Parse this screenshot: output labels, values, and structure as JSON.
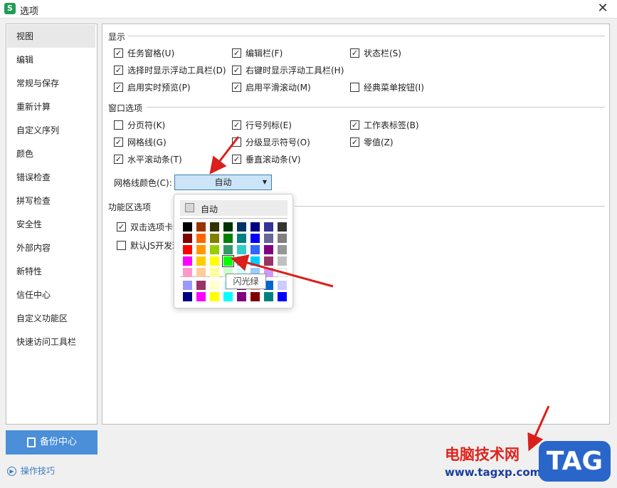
{
  "window": {
    "title": "选项",
    "app_icon": "S"
  },
  "sidebar": {
    "items": [
      {
        "label": "视图",
        "active": true
      },
      {
        "label": "编辑"
      },
      {
        "label": "常规与保存"
      },
      {
        "label": "重新计算"
      },
      {
        "label": "自定义序列"
      },
      {
        "label": "颜色"
      },
      {
        "label": "错误检查"
      },
      {
        "label": "拼写检查"
      },
      {
        "label": "安全性"
      },
      {
        "label": "外部内容"
      },
      {
        "label": "新特性"
      },
      {
        "label": "信任中心"
      },
      {
        "label": "自定义功能区"
      },
      {
        "label": "快速访问工具栏"
      }
    ],
    "backup_label": "备份中心",
    "tips_label": "操作技巧"
  },
  "sections": {
    "display": {
      "title": "显示",
      "options": [
        {
          "label": "任务窗格(U)",
          "checked": true
        },
        {
          "label": "编辑栏(F)",
          "checked": true
        },
        {
          "label": "状态栏(S)",
          "checked": true
        },
        {
          "label": "选择时显示浮动工具栏(D)",
          "checked": true
        },
        {
          "label": "右键时显示浮动工具栏(H)",
          "checked": true
        },
        {
          "label": "启用实时预览(P)",
          "checked": true
        },
        {
          "label": "启用平滑滚动(M)",
          "checked": true
        },
        {
          "label": "经典菜单按钮(I)",
          "checked": false
        }
      ]
    },
    "window_options": {
      "title": "窗口选项",
      "options": [
        {
          "label": "分页符(K)",
          "checked": false
        },
        {
          "label": "行号列标(E)",
          "checked": true
        },
        {
          "label": "工作表标签(B)",
          "checked": true
        },
        {
          "label": "网格线(G)",
          "checked": true
        },
        {
          "label": "分级显示符号(O)",
          "checked": false
        },
        {
          "label": "零值(Z)",
          "checked": true
        },
        {
          "label": "水平滚动条(T)",
          "checked": true
        },
        {
          "label": "垂直滚动条(V)",
          "checked": true
        }
      ],
      "grid_color_label": "网格线颜色(C):",
      "grid_color_value": "自动"
    },
    "ribbon": {
      "title": "功能区选项",
      "options": [
        {
          "label": "双击选项卡时",
          "checked": true
        },
        {
          "label": "默认JS开发环",
          "checked": false
        }
      ]
    }
  },
  "color_popup": {
    "auto_label": "自动",
    "tooltip": "闪光绿",
    "colors": [
      [
        "#000000",
        "#993300",
        "#333300",
        "#003300",
        "#003366",
        "#000080",
        "#333399",
        "#333333"
      ],
      [
        "#800000",
        "#ff6600",
        "#808000",
        "#008000",
        "#008080",
        "#0000ff",
        "#666699",
        "#808080"
      ],
      [
        "#ff0000",
        "#ff9900",
        "#99cc00",
        "#339966",
        "#33cccc",
        "#3366ff",
        "#800080",
        "#969696"
      ],
      [
        "#ff00ff",
        "#ffcc00",
        "#ffff00",
        "#00ff00",
        "#00ffff",
        "#00ccff",
        "#993366",
        "#c0c0c0"
      ],
      [
        "#ff99cc",
        "#ffcc99",
        "#ffff99",
        "#ccffcc",
        "#ccffff",
        "#99ccff",
        "#cc99ff",
        "#ffffff"
      ]
    ],
    "custom_colors": [
      [
        "#9999ff",
        "#993366",
        "#ffffcc",
        "#ccffff",
        "#660066",
        "#ff8080",
        "#0066cc",
        "#ccccff"
      ],
      [
        "#000080",
        "#ff00ff",
        "#ffff00",
        "#00ffff",
        "#800080",
        "#800000",
        "#008080",
        "#0000ff"
      ]
    ],
    "selected": "#00ff00"
  },
  "watermark": {
    "text": "电脑技术网",
    "url": "www.tagxp.com",
    "tag": "TAG"
  }
}
